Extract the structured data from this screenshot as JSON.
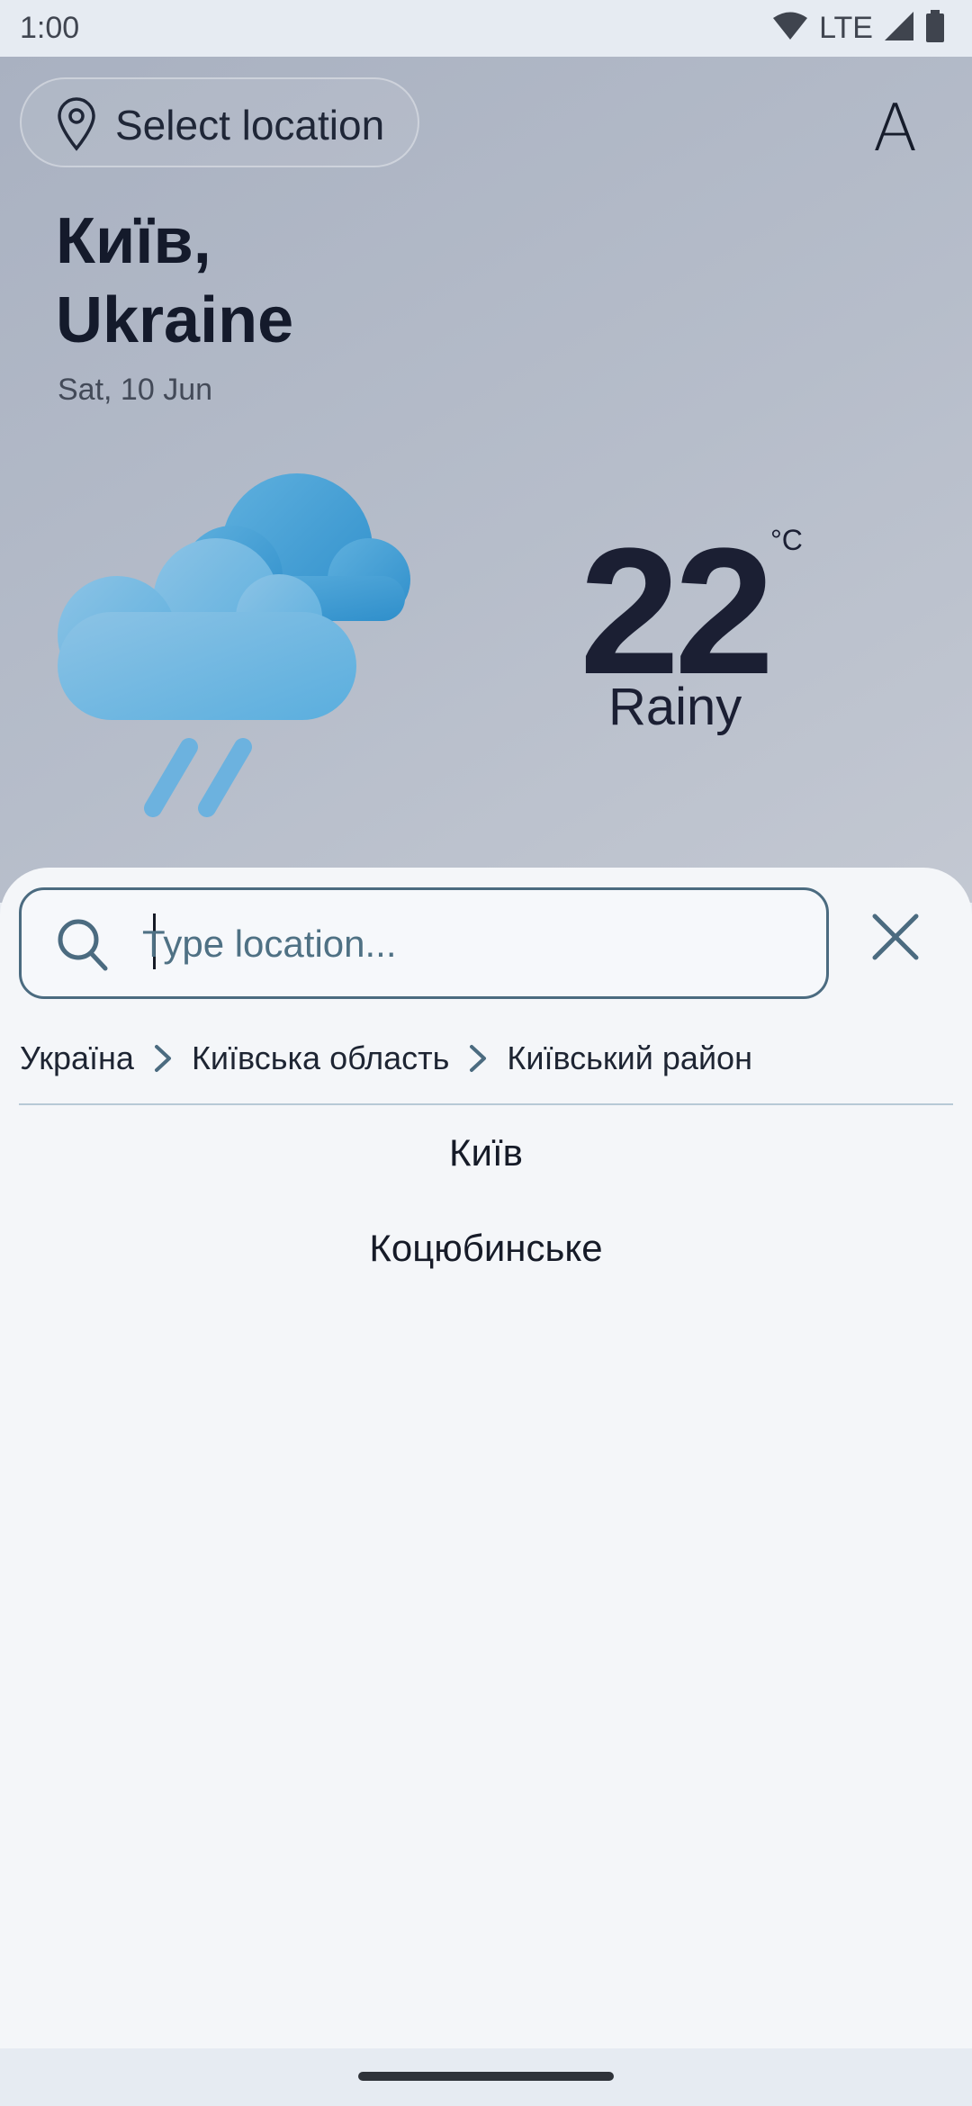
{
  "status_bar": {
    "time": "1:00",
    "network": "LTE",
    "icons": [
      "wifi-icon",
      "signal-icon",
      "battery-icon"
    ]
  },
  "header": {
    "select_location_label": "Select location",
    "font_size_button_label": "A"
  },
  "weather": {
    "city_line1": "Київ,",
    "city_line2": "Ukraine",
    "date": "Sat, 10 Jun",
    "temperature": "22",
    "unit": "°C",
    "condition": "Rainy",
    "icon": "rain-cloud-icon"
  },
  "search": {
    "placeholder": "Type location...",
    "value": ""
  },
  "breadcrumb": [
    "Україна",
    "Київська область",
    "Київський район"
  ],
  "results": [
    "Київ",
    "Коцюбинське"
  ],
  "colors": {
    "accent": "#4b6b80",
    "text_dark": "#141a2b",
    "sheet_background": "#f4f6f9",
    "cloud_blue": "#5aaede"
  }
}
